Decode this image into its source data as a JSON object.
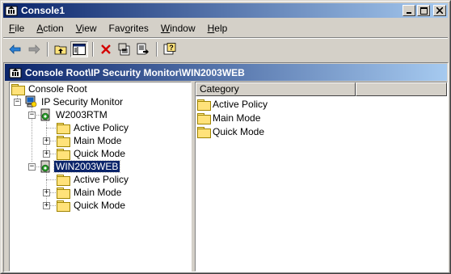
{
  "window": {
    "title": "Console1",
    "icon": "mmc-console-icon"
  },
  "menubar": {
    "items": [
      {
        "label": "File",
        "u": "F",
        "rest": "ile"
      },
      {
        "label": "Action",
        "u": "A",
        "rest": "ction"
      },
      {
        "label": "View",
        "u": "V",
        "rest": "iew"
      },
      {
        "label": "Favorites",
        "u": "",
        "rest": "Fav",
        "u2": "o",
        "rest2": "rites"
      },
      {
        "label": "Window",
        "u": "W",
        "rest": "indow"
      },
      {
        "label": "Help",
        "u": "H",
        "rest": "elp"
      }
    ]
  },
  "toolbar": {
    "buttons": [
      "back-arrow-icon",
      "forward-arrow-icon",
      "up-one-level-icon",
      "show-hide-tree-icon",
      "delete-icon",
      "properties-icon",
      "export-list-icon",
      "help-icon"
    ]
  },
  "child": {
    "title": "Console Root\\IP Security Monitor\\WIN2003WEB"
  },
  "tree": {
    "root": "Console Root",
    "monitor": "IP Security Monitor",
    "server1": "W2003RTM",
    "server1_children": [
      "Active Policy",
      "Main Mode",
      "Quick Mode"
    ],
    "server2": "WIN2003WEB",
    "server2_children": [
      "Active Policy",
      "Main Mode",
      "Quick Mode"
    ]
  },
  "list": {
    "column": "Category",
    "items": [
      "Active Policy",
      "Main Mode",
      "Quick Mode"
    ]
  },
  "colors": {
    "titlebar_start": "#0a246a",
    "titlebar_end": "#a6caf0",
    "face": "#d4d0c8",
    "folder": "#ffe27a"
  }
}
